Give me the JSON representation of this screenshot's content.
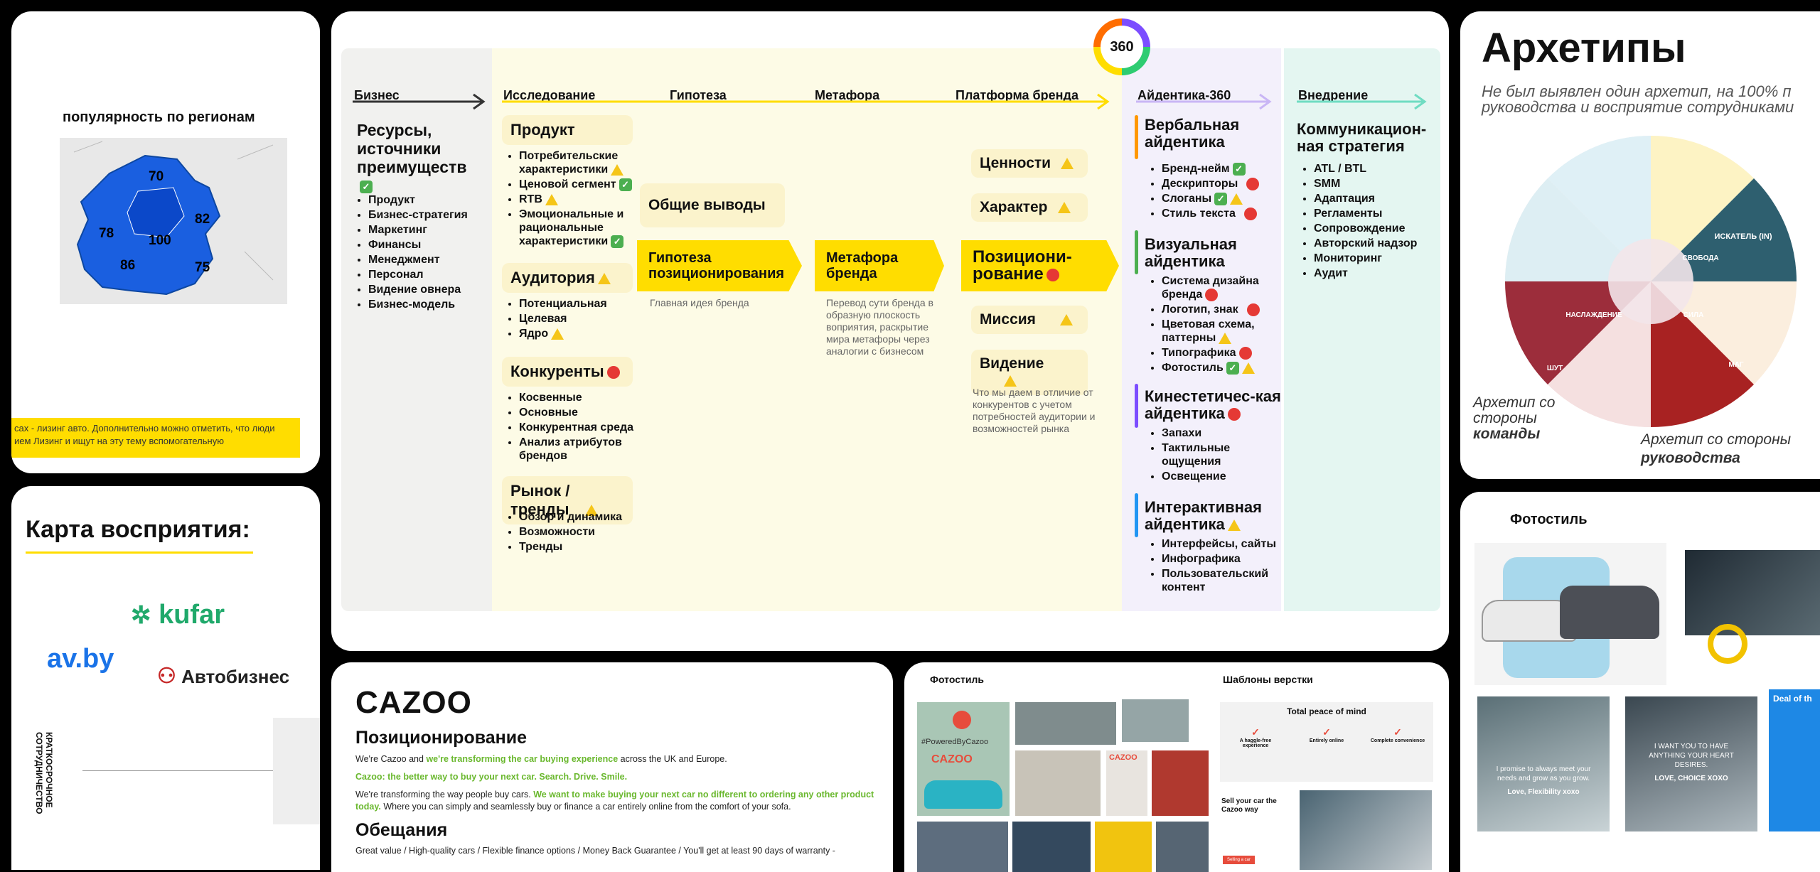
{
  "left_top": {
    "title": "популярность по регионам",
    "regions": [
      "70",
      "82",
      "78",
      "100",
      "86",
      "75"
    ],
    "footer_text_1": "сах - лизинг авто. Дополнительно можно отметить, что люди",
    "footer_text_2": "ием Лизинг и ищут на эту тему вспомогательную"
  },
  "left_bottom": {
    "title": "Карта восприятия:",
    "brand_kufar": "kufar",
    "brand_avby": "av.by",
    "brand_avtobiznes": "Автобизнес",
    "vertical_label_1": "КРАТКОСРОЧНОЕ",
    "vertical_label_2": "СОТРУДНИЧЕСТВО"
  },
  "main": {
    "badge": "360",
    "cols": {
      "business": "Бизнес",
      "research": "Исследование",
      "hypothesis": "Гипотеза",
      "metaphor": "Метафора",
      "platform": "Платформа бренда",
      "identity": "Айдентика-360",
      "implementation": "Внедрение"
    },
    "business": {
      "title": "Ресурсы, источники преимуществ",
      "items": [
        "Продукт",
        "Бизнес-стратегия",
        "Маркетинг",
        "Финансы",
        "Менеджмент",
        "Персонал",
        "Видение овнера",
        "Бизнес-модель"
      ]
    },
    "research": {
      "product_title": "Продукт",
      "product_items": [
        "Потребительские характеристики",
        "Ценовой сегмент",
        "RTB",
        "Эмоциональные и рациональные характеристики"
      ],
      "audience_title": "Аудитория",
      "audience_items": [
        "Потенциальная",
        "Целевая",
        "Ядро"
      ],
      "competitors_title": "Конкуренты",
      "competitors_items": [
        "Косвенные",
        "Основные",
        "Конкурентная среда",
        "Анализ атрибутов брендов"
      ],
      "market_title": "Рынок / тренды",
      "market_items": [
        "Обзор и динамика",
        "Возможности",
        "Тренды"
      ]
    },
    "hypothesis": {
      "general": "Общие выводы",
      "title": "Гипотеза позиционирования",
      "note": "Главная идея бренда"
    },
    "metaphor": {
      "title": "Метафора бренда",
      "note": "Перевод сути бренда в образную плоскость воприятия, раскрытие мира метафоры через аналогии с бизнесом"
    },
    "platform": {
      "values": "Ценности",
      "character": "Характер",
      "positioning": "Позициони-рование",
      "mission": "Миссия",
      "vision": "Видение",
      "note": "Что мы даем в отличие от конкурентов с учетом потребностей аудитории и возможностей рынка"
    },
    "identity": {
      "verbal_title": "Вербальная айдентика",
      "verbal_items": [
        "Бренд-нейм",
        "Дескрипторы",
        "Слоганы",
        "Стиль текста"
      ],
      "visual_title": "Визуальная айдентика",
      "visual_items": [
        "Система дизайна бренда",
        "Логотип, знак",
        "Цветовая схема, паттерны",
        "Типографика",
        "Фотостиль"
      ],
      "kinesthetic_title": "Кинестетичес-кая айдентика",
      "kinesthetic_items": [
        "Запахи",
        "Тактильные ощущения",
        "Освещение"
      ],
      "interactive_title": "Интерактивная айдентика",
      "interactive_items": [
        "Интерфейсы, сайты",
        "Инфографика",
        "Пользовательский контент"
      ]
    },
    "implementation": {
      "title": "Коммуникацион-ная стратегия",
      "items": [
        "ATL / BTL",
        "SMM",
        "Адаптация",
        "Регламенты",
        "Сопровождение",
        "Авторский надзор",
        "Мониторинг",
        "Аудит"
      ]
    }
  },
  "archetypes": {
    "title": "Архетипы",
    "subtitle_1": "Не был выявлен один архетип, на 100% п",
    "subtitle_2": "руководства и восприятие сотрудниками",
    "label_team_1": "Архетип со",
    "label_team_2": "стороны",
    "label_team_3": "команды",
    "label_lead_1": "Архетип со стороны",
    "label_lead_2": "руководства",
    "wheel_labels": [
      "ИСКАТЕЛЬ (IN)",
      "СВОБОДА",
      "СИЛА",
      "МАГ",
      "НАСЛАЖДЕНИЕ",
      "ШУТ"
    ]
  },
  "photo_right": {
    "title": "Фотостиль",
    "banner": "Deal of th",
    "caption_1": "I promise to always meet your needs and grow as you grow.",
    "caption_1b": "Love, Flexibility xoxo",
    "caption_2": "I WANT YOU TO HAVE ANYTHING YOUR HEART DESIRES.",
    "caption_2b": "LOVE, CHOICE XOXO"
  },
  "cazoo": {
    "logo": "CAZOO",
    "positioning_title": "Позиционирование",
    "p1_a": "We're Cazoo and ",
    "p1_b": "we're transforming the car buying experience",
    "p1_c": " across the UK and Europe.",
    "p2": "Cazoo: the better way to buy your next car. Search. Drive. Smile.",
    "p3_a": "We're transforming the way people buy cars. ",
    "p3_b": "We want to make buying your next car no different to ordering any other product today.",
    "p3_c": " Where you can simply and seamlessly buy or finance a car entirely online from the comfort of your sofa.",
    "promises_title": "Обещания",
    "promises_text": "Great value / High-quality cars / Flexible finance options / Money Back Guarantee / You'll get at least 90 days of warranty -"
  },
  "cazoo_photos": {
    "photostyle_title": "Фотостиль",
    "templates_title": "Шаблоны верстки",
    "powered": "#PoweredByCazoo",
    "brand": "CAZOO",
    "peace_title": "Total peace of mind",
    "feat_1": "A haggle-free experience",
    "feat_2": "Entirely online",
    "feat_3": "Complete convenience",
    "sell_title": "Sell your car the Cazoo way",
    "sell_btn": "Selling a car"
  }
}
